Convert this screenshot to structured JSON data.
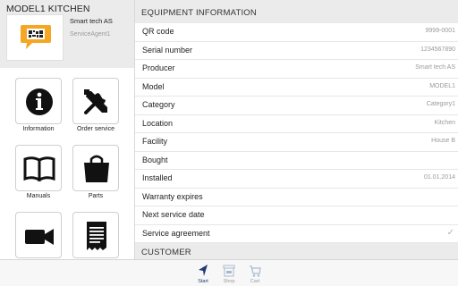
{
  "left": {
    "model_title": "MODEL1 KITCHEN",
    "company": "Smart tech AS",
    "agent": "ServiceAgent1",
    "tiles": [
      {
        "label": "Information",
        "icon": "info-icon"
      },
      {
        "label": "Order service",
        "icon": "tools-icon"
      },
      {
        "label": "Manuals",
        "icon": "book-icon"
      },
      {
        "label": "Parts",
        "icon": "shopping-bag-icon"
      },
      {
        "label": "",
        "icon": "video-camera-icon"
      },
      {
        "label": "",
        "icon": "document-icon"
      }
    ]
  },
  "equipment": {
    "title": "EQUIPMENT INFORMATION",
    "rows": [
      {
        "label": "QR code",
        "value": "9999-0001"
      },
      {
        "label": "Serial number",
        "value": "1234567890"
      },
      {
        "label": "Producer",
        "value": "Smart tech AS"
      },
      {
        "label": "Model",
        "value": "MODEL1"
      },
      {
        "label": "Category",
        "value": "Category1"
      },
      {
        "label": "Location",
        "value": "Kitchen"
      },
      {
        "label": "Facility",
        "value": "House B"
      },
      {
        "label": "Bought",
        "value": ""
      },
      {
        "label": "Installed",
        "value": "01.01.2014"
      },
      {
        "label": "Warranty expires",
        "value": ""
      },
      {
        "label": "Next service date",
        "value": ""
      },
      {
        "label": "Service agreement",
        "value": "✓"
      }
    ]
  },
  "customer": {
    "title": "CUSTOMER"
  },
  "tabbar": {
    "tabs": [
      {
        "label": "Start",
        "icon": "navigation-arrow-icon",
        "active": true
      },
      {
        "label": "Shop",
        "icon": "shop-icon",
        "active": false
      },
      {
        "label": "Cart",
        "icon": "cart-icon",
        "active": false
      }
    ]
  },
  "colors": {
    "header_bg": "#ebebeb",
    "active_tab": "#1f3b7a",
    "muted_text": "#9a9a9a",
    "logo_orange": "#f5a623"
  }
}
